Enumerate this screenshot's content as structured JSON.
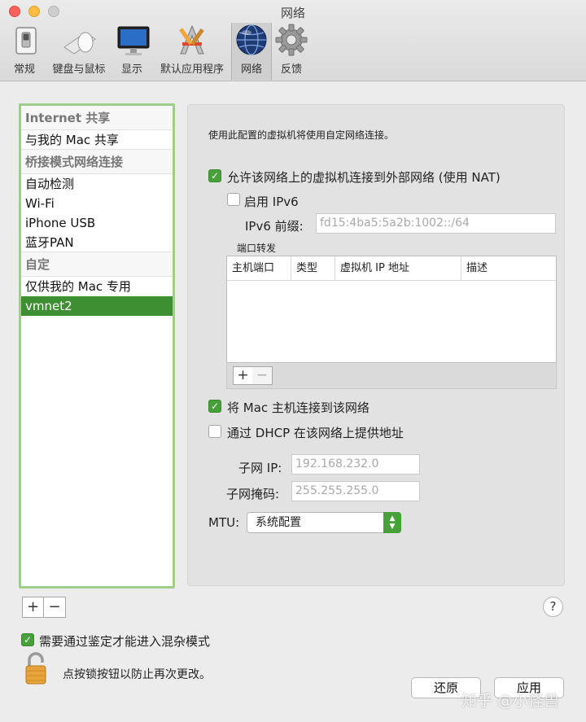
{
  "window": {
    "title": "网络"
  },
  "toolbar": [
    {
      "label": "常规",
      "icon": "switch-icon"
    },
    {
      "label": "键盘与鼠标",
      "icon": "keyboard-mouse-icon"
    },
    {
      "label": "显示",
      "icon": "display-icon"
    },
    {
      "label": "默认应用程序",
      "icon": "app-tools-icon"
    },
    {
      "label": "网络",
      "icon": "globe-icon"
    },
    {
      "label": "反馈",
      "icon": "gear-icon"
    }
  ],
  "sidebar": {
    "items": [
      {
        "label": "Internet 共享",
        "kind": "header"
      },
      {
        "label": "与我的 Mac 共享",
        "kind": "item"
      },
      {
        "label": "桥接模式网络连接",
        "kind": "header"
      },
      {
        "label": "自动检测",
        "kind": "item"
      },
      {
        "label": "Wi-Fi",
        "kind": "item"
      },
      {
        "label": "iPhone USB",
        "kind": "item"
      },
      {
        "label": "蓝牙PAN",
        "kind": "item"
      },
      {
        "label": "自定",
        "kind": "header"
      },
      {
        "label": "仅供我的 Mac 专用",
        "kind": "item"
      },
      {
        "label": "vmnet2",
        "kind": "selected"
      }
    ],
    "add_label": "+",
    "remove_label": "−"
  },
  "panel": {
    "description": "使用此配置的虚拟机将使用自定网络连接。",
    "nat_checkbox": {
      "label": "允许该网络上的虚拟机连接到外部网络 (使用 NAT)",
      "checked": true
    },
    "ipv6_checkbox": {
      "label": "启用 IPv6",
      "checked": false
    },
    "ipv6_prefix_label": "IPv6 前缀:",
    "ipv6_prefix_value": "fd15:4ba5:5a2b:1002::/64",
    "port_forward_label": "端口转发",
    "table_columns": [
      "主机端口",
      "类型",
      "虚拟机 IP 地址",
      "描述"
    ],
    "table_add": "+",
    "table_remove": "−",
    "connect_mac_checkbox": {
      "label": "将 Mac 主机连接到该网络",
      "checked": true
    },
    "dhcp_checkbox": {
      "label": "通过 DHCP 在该网络上提供地址",
      "checked": false
    },
    "subnet_ip_label": "子网 IP:",
    "subnet_ip_value": "192.168.232.0",
    "subnet_mask_label": "子网掩码:",
    "subnet_mask_value": "255.255.255.0",
    "mtu_label": "MTU:",
    "mtu_value": "系统配置"
  },
  "help_label": "?",
  "promiscuous_checkbox": {
    "label": "需要通过鉴定才能进入混杂模式",
    "checked": true
  },
  "lock_text": "点按锁按钮以防止再次更改。",
  "buttons": {
    "revert": "还原",
    "apply": "应用"
  },
  "watermark": "知乎 @小怪兽",
  "colors": {
    "accent": "#47a03a",
    "list_border": "#9fcd8b"
  }
}
